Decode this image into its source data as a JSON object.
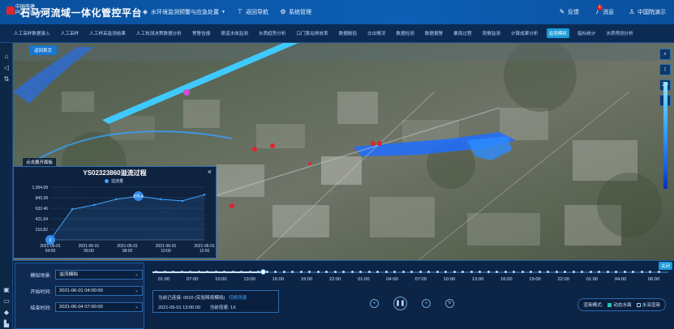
{
  "header": {
    "brand_cn": "中国电建",
    "brand_en": "POWERCHINA",
    "title": "石马河流域一体化管控平台",
    "menu_items": [
      {
        "label": "水环境监测预警与应急处置",
        "icon": "droplet-icon"
      },
      {
        "label": "返回导航",
        "icon": "sign-icon"
      },
      {
        "label": "系统管理",
        "icon": "gear-icon"
      }
    ],
    "right_items": [
      {
        "label": "反馈",
        "icon": "feedback-icon"
      },
      {
        "label": "消息",
        "icon": "bell-icon",
        "badge": "1"
      },
      {
        "label": "中国院演示",
        "icon": "user-icon"
      }
    ]
  },
  "nav": {
    "items": [
      "人工采样数据录入",
      "人工采样",
      "人工样采监测结果",
      "人工校测决策数据分析",
      "预警告报",
      "渠道水体监测",
      "水质趋势分析",
      "口门泵站排放率",
      "数据概括",
      "交出情况",
      "数据检测",
      "数据报警",
      "暴雨过程",
      "雨情监测",
      "计算成果分析",
      "溢流模拟",
      "指标统计",
      "水质预测分析"
    ],
    "active_index": 15
  },
  "map": {
    "return_button": "返回首页",
    "expand_tag": "点击展开面板",
    "tools": [
      "search-icon",
      "share-icon",
      "2D",
      "layers-icon"
    ]
  },
  "chart_panel": {
    "close": "×",
    "chart_data": {
      "type": "line",
      "title": "YS02323860溢流过程",
      "series": [
        {
          "name": "溢流量",
          "values": [
            0,
            612,
            700,
            812,
            876.4,
            812,
            780,
            903
          ]
        }
      ],
      "x": [
        "2021-06-01 04:00",
        "2021-06-01 05:00",
        "2021-06-01 06:00",
        "2021-06-01 07:00",
        "2021-06-01 08:00",
        "2021-06-01 09:00",
        "2021-06-01 10:00",
        "2021-06-01 12:00"
      ],
      "x_tick_labels": [
        [
          "2021-06-01",
          "04:00"
        ],
        [
          "2021-06-01",
          "06:00"
        ],
        [
          "2021-06-01",
          "08:00"
        ],
        [
          "2021-06-01",
          "10:00"
        ],
        [
          "2021-06-01",
          "12:00"
        ]
      ],
      "y_tick_labels": [
        "1,054.08",
        "843.28",
        "632.46",
        "421.64",
        "210.82",
        "0"
      ],
      "ylim": [
        0,
        1054.08
      ],
      "data_labels": [
        {
          "index": 0,
          "text": "0"
        },
        {
          "index": 4,
          "text": "876.4"
        }
      ],
      "grid": true
    }
  },
  "bottom": {
    "form": [
      {
        "label": "模拟场景:",
        "value": "溢流模拟"
      },
      {
        "label": "开始时间:",
        "value": "2021-06-01 04:00:00"
      },
      {
        "label": "结束时间:",
        "value": "2021-06-04 07:00:00"
      }
    ],
    "timeline": {
      "labels": [
        "01:00",
        "07:00",
        "10:00",
        "13:00",
        "16:00",
        "19:00",
        "22:00",
        "01:00",
        "04:00",
        "07:00",
        "10:00",
        "13:00",
        "16:00",
        "19:00",
        "22:00",
        "01:00",
        "04:00"
      ],
      "end_label": "06:00",
      "progress_fraction": 0.22,
      "close_tag": "关闭"
    },
    "info": {
      "line1_prefix": "当前已连接:",
      "line1_value": "0610 (实验降雨模拟)",
      "line1_link": "切换场景",
      "line2_time": "2021-06-01 13:00:00",
      "line2_speed_label": "当前倍速:",
      "line2_speed_value": "1X"
    },
    "controls": [
      "rewind-icon",
      "pause-icon",
      "forward-icon",
      "reset-icon"
    ],
    "mode": {
      "label": "渲染模式:",
      "option1": "动态水面",
      "option2": "水深渲染"
    }
  }
}
